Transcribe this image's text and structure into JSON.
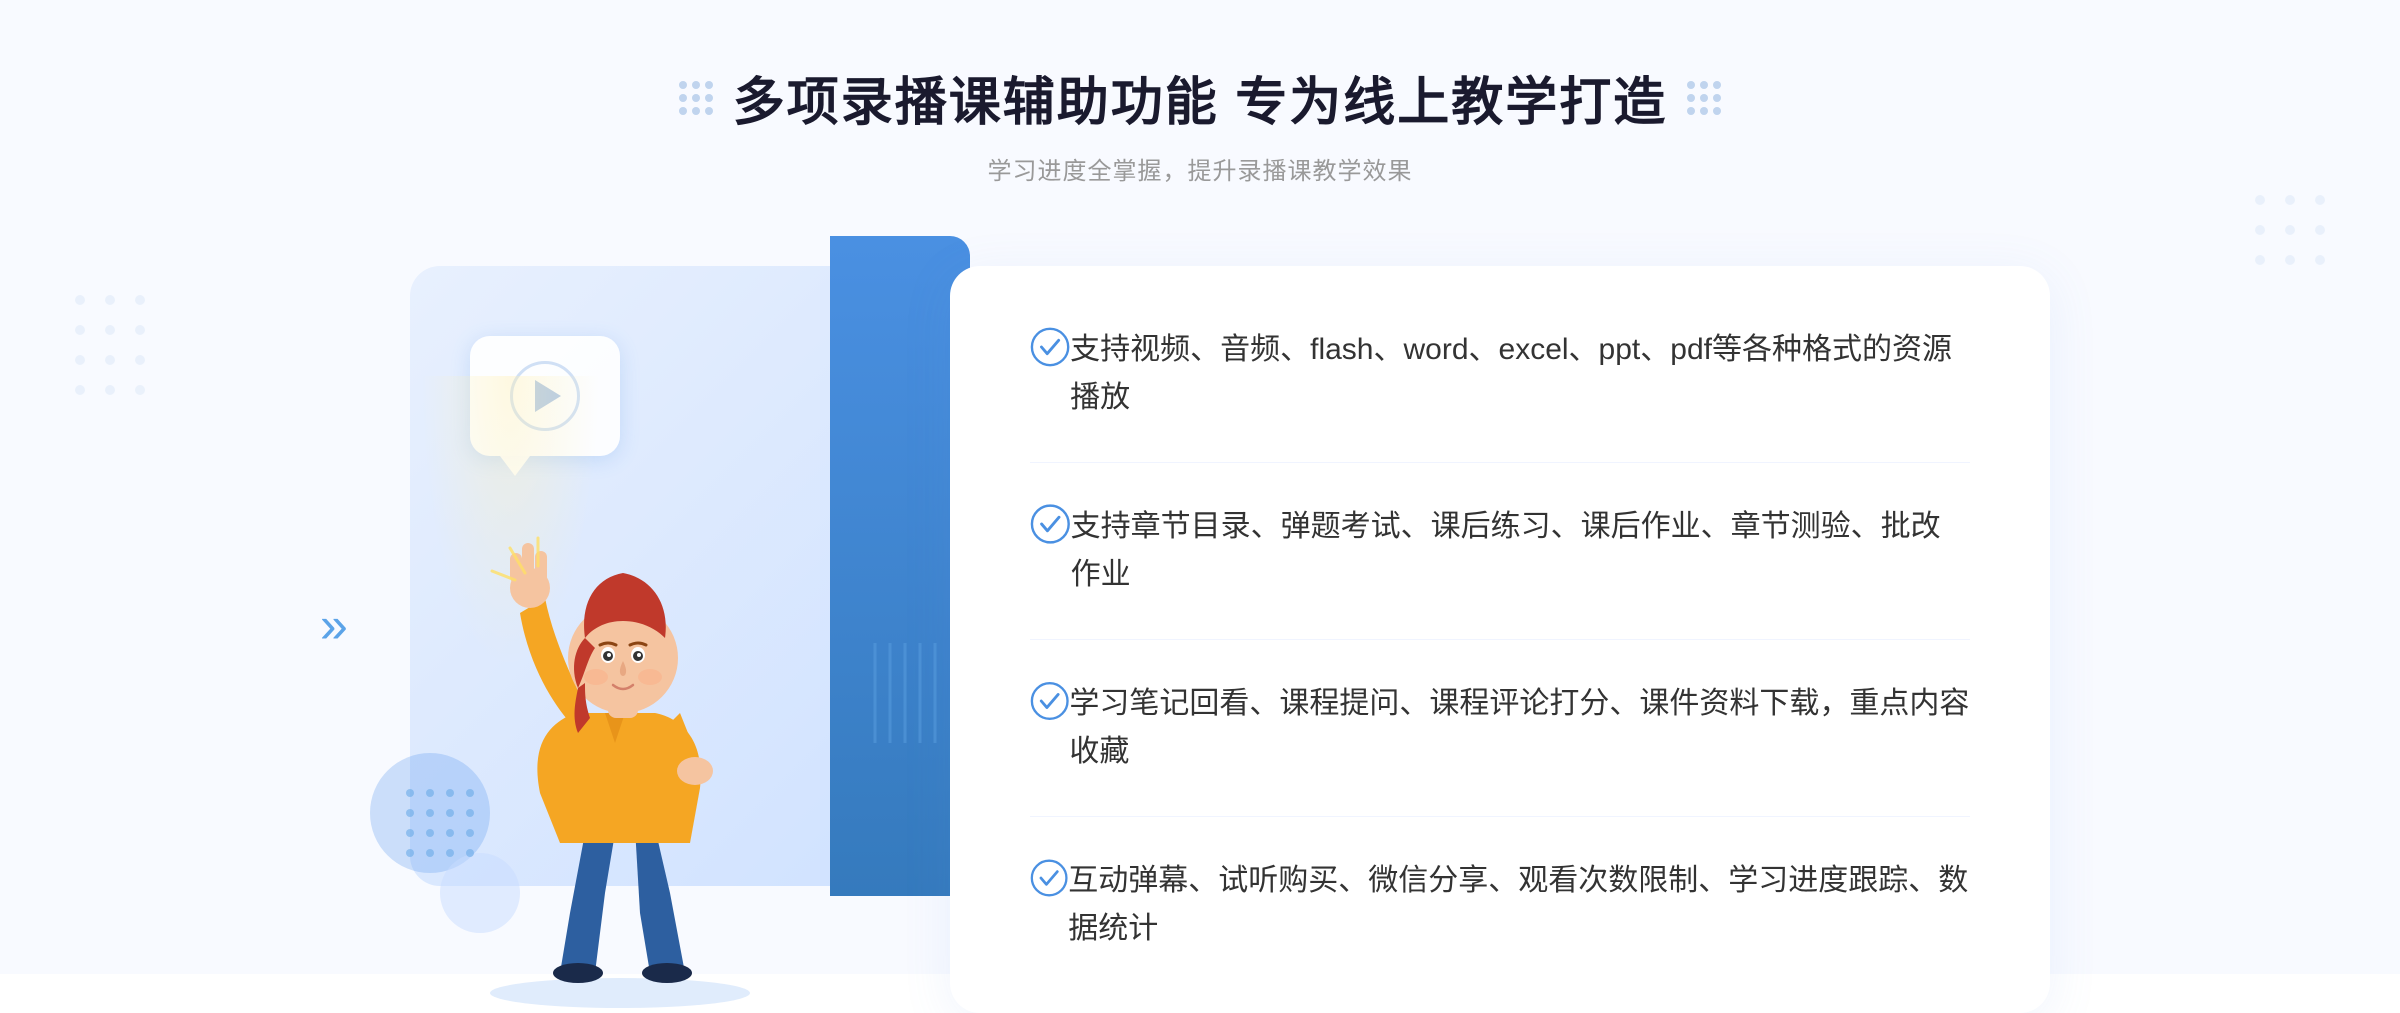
{
  "header": {
    "title": "多项录播课辅助功能 专为线上教学打造",
    "subtitle": "学习进度全掌握，提升录播课教学效果"
  },
  "features": [
    {
      "id": "feature-1",
      "text": "支持视频、音频、flash、word、excel、ppt、pdf等各种格式的资源播放"
    },
    {
      "id": "feature-2",
      "text": "支持章节目录、弹题考试、课后练习、课后作业、章节测验、批改作业"
    },
    {
      "id": "feature-3",
      "text": "学习笔记回看、课程提问、课程评论打分、课件资料下载，重点内容收藏"
    },
    {
      "id": "feature-4",
      "text": "互动弹幕、试听购买、微信分享、观看次数限制、学习进度跟踪、数据统计"
    }
  ],
  "decorations": {
    "left_arrow": "»",
    "check_color": "#4a90e2"
  }
}
